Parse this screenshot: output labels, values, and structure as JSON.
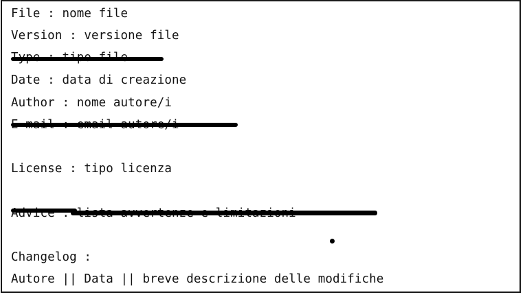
{
  "document": {
    "lines": {
      "file": "File : nome file",
      "version": "Version : versione file",
      "type": "Type : tipo file",
      "date": "Date : data di creazione",
      "author": "Author : nome autore/i",
      "email": "E-mail : email autore/i",
      "license": "License : tipo licenza",
      "advice": "Advice : lista avvertenze e limitazioni",
      "changelog_heading": "Changelog :",
      "changelog_format": "Autore || Data || breve descrizione delle modifiche"
    },
    "struck_out": [
      "type",
      "email",
      "advice"
    ]
  }
}
